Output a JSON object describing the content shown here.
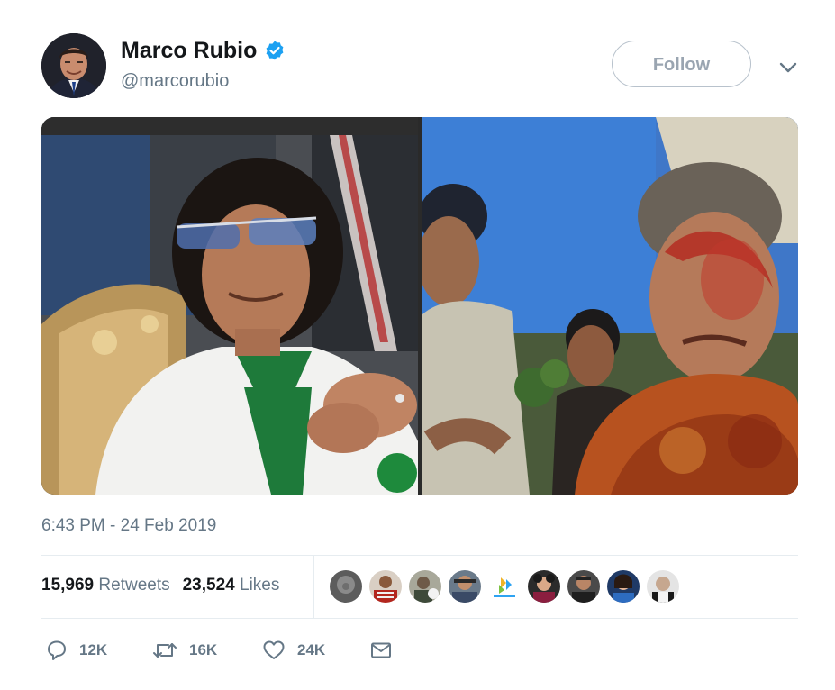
{
  "author": {
    "display_name": "Marco Rubio",
    "handle": "@marcorubio",
    "verified_icon": "verified-badge-icon",
    "avatar_icon": "avatar"
  },
  "follow_label": "Follow",
  "menu_icon": "chevron-down-icon",
  "media": {
    "images": [
      "photo-left",
      "photo-right"
    ]
  },
  "timestamp": "6:43 PM - 24 Feb 2019",
  "stats": {
    "retweets_count": "15,969",
    "retweets_label": "Retweets",
    "likes_count": "23,524",
    "likes_label": "Likes"
  },
  "likers_count_shown": 9,
  "actions": {
    "reply_count": "12K",
    "retweet_count": "16K",
    "like_count": "24K"
  },
  "colors": {
    "text_primary": "#14171a",
    "text_secondary": "#657786",
    "verified_blue": "#1da1f2",
    "divider": "#e6ecf0",
    "follow_border": "#b8c2cc"
  }
}
